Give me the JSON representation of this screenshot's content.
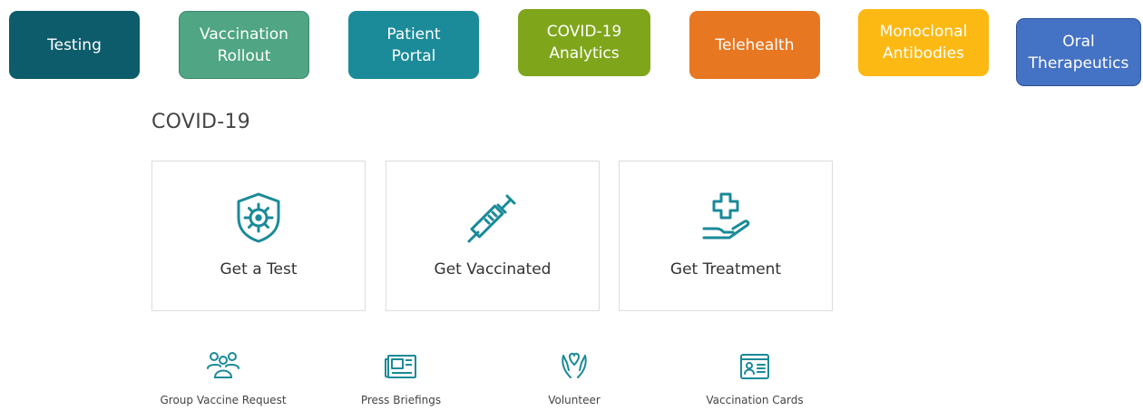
{
  "tabs": [
    {
      "label": "Testing",
      "color": "#0d5c6b"
    },
    {
      "label": "Vaccination\nRollout",
      "color": "#4fa584"
    },
    {
      "label": "Patient\nPortal",
      "color": "#1b8b99"
    },
    {
      "label": "COVID-19\nAnalytics",
      "color": "#7fa61b"
    },
    {
      "label": "Telehealth",
      "color": "#e87722"
    },
    {
      "label": "Monoclonal\nAntibodies",
      "color": "#fdb913"
    },
    {
      "label": "Oral\nTherapeutics",
      "color": "#4472c4"
    }
  ],
  "page": {
    "title": "COVID-19"
  },
  "cards": [
    {
      "label": "Get a Test",
      "icon": "virus-shield-icon"
    },
    {
      "label": "Get Vaccinated",
      "icon": "syringe-icon"
    },
    {
      "label": "Get Treatment",
      "icon": "hand-cross-icon"
    }
  ],
  "links": [
    {
      "label": "Group Vaccine Request",
      "icon": "group-icon"
    },
    {
      "label": "Press Briefings",
      "icon": "newspaper-icon"
    },
    {
      "label": "Volunteer",
      "icon": "heart-hands-icon"
    },
    {
      "label": "Vaccination Cards",
      "icon": "id-card-icon"
    }
  ],
  "icon_color": "#1a8a99"
}
